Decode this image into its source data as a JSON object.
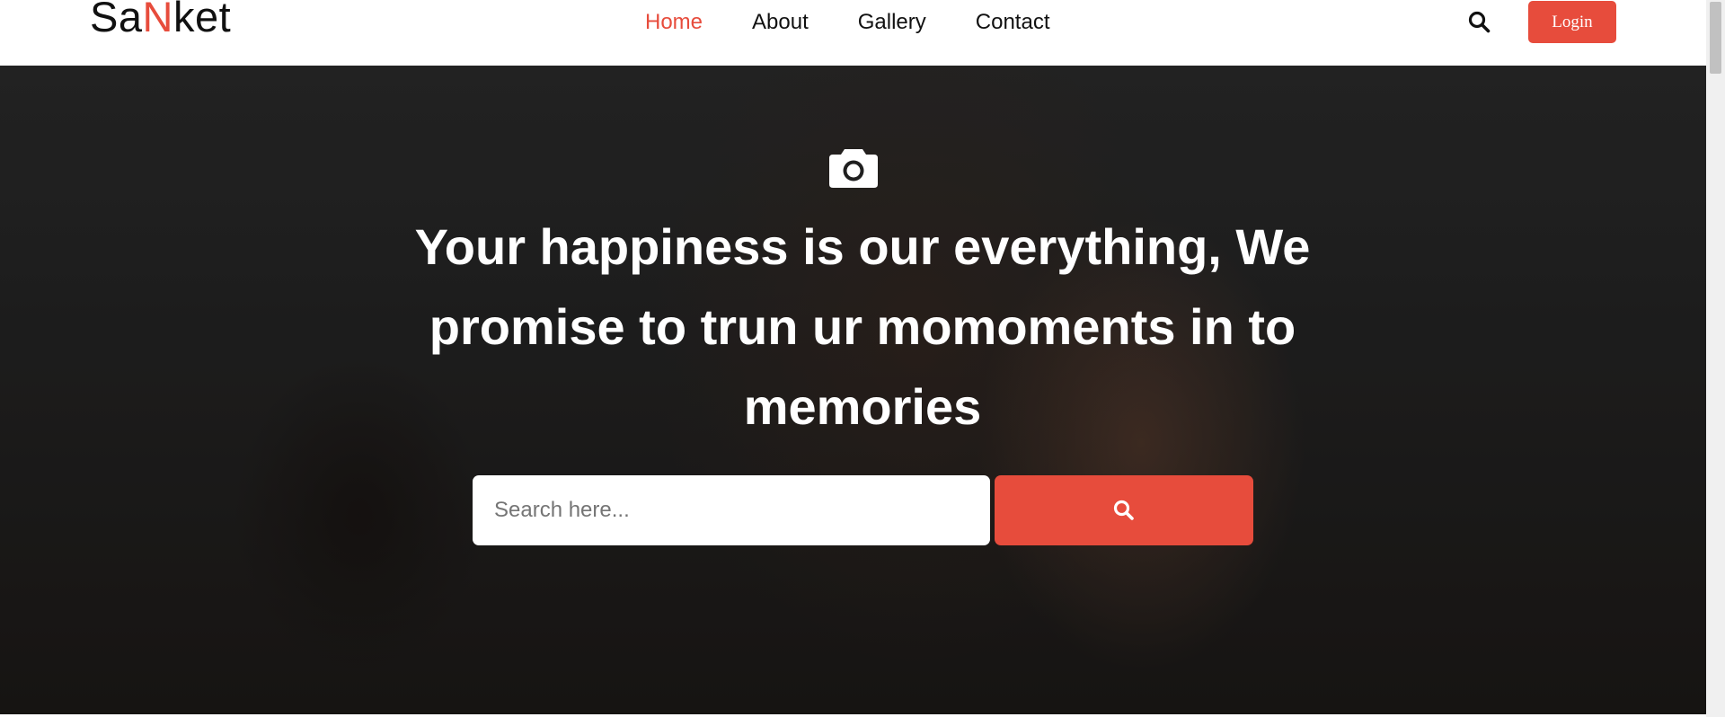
{
  "brand": {
    "logo_prefix": "Sa",
    "logo_accent": "N",
    "logo_suffix": "ket",
    "accent_color": "#e74c3c"
  },
  "nav": {
    "items": [
      {
        "label": "Home",
        "active": true
      },
      {
        "label": "About",
        "active": false
      },
      {
        "label": "Gallery",
        "active": false
      },
      {
        "label": "Contact",
        "active": false
      }
    ],
    "search_icon": "search-icon",
    "login_label": "Login"
  },
  "hero": {
    "icon": "camera-icon",
    "headline": "Your happiness is our everything, We promise to trun ur momoments in to memories",
    "search": {
      "placeholder": "Search here...",
      "value": "",
      "button_icon": "search-icon"
    }
  }
}
